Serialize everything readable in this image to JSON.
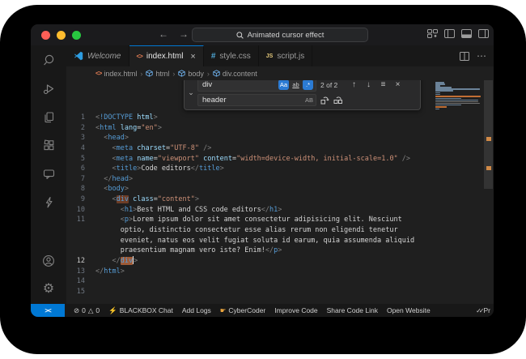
{
  "titlebar": {
    "search_query": "Animated cursor effect",
    "back": "←",
    "forward": "→"
  },
  "tabs": [
    {
      "label": "Welcome"
    },
    {
      "label": "index.html",
      "close": "×"
    },
    {
      "label": "style.css"
    },
    {
      "label": "script.js"
    }
  ],
  "file_icons": {
    "html": "<>",
    "css": "#",
    "js": "JS"
  },
  "breadcrumb": {
    "items": [
      "index.html",
      "html",
      "body",
      "div.content"
    ],
    "separator": "›"
  },
  "find": {
    "query": "div",
    "match_case": "Aa",
    "whole_word": "ab",
    "regex": ".*",
    "results": "2 of 2",
    "replace_value": "header",
    "preserve_case": "AB",
    "prev": "↑",
    "next": "↓",
    "in_selection": "≡",
    "close": "×",
    "collapse": "⌄"
  },
  "code": {
    "rows": [
      {
        "n": "1",
        "seg": [
          [
            "<",
            "p"
          ],
          [
            "!DOCTYPE",
            "t"
          ],
          [
            " html",
            "a"
          ],
          [
            ">",
            "p"
          ]
        ]
      },
      {
        "n": "2",
        "seg": [
          [
            "<",
            "p"
          ],
          [
            "html",
            "t"
          ],
          [
            " ",
            "x"
          ],
          [
            "lang",
            "a"
          ],
          [
            "=",
            "x"
          ],
          [
            "\"en\"",
            "s"
          ],
          [
            ">",
            "p"
          ]
        ]
      },
      {
        "n": "3",
        "seg": [
          [
            "  ",
            "x"
          ],
          [
            "<",
            "p"
          ],
          [
            "head",
            "t"
          ],
          [
            ">",
            "p"
          ]
        ]
      },
      {
        "n": "4",
        "seg": [
          [
            "    ",
            "x"
          ],
          [
            "<",
            "p"
          ],
          [
            "meta",
            "t"
          ],
          [
            " ",
            "x"
          ],
          [
            "charset",
            "a"
          ],
          [
            "=",
            "x"
          ],
          [
            "\"UTF-8\"",
            "s"
          ],
          [
            " />",
            "p"
          ]
        ]
      },
      {
        "n": "5",
        "seg": [
          [
            "    ",
            "x"
          ],
          [
            "<",
            "p"
          ],
          [
            "meta",
            "t"
          ],
          [
            " ",
            "x"
          ],
          [
            "name",
            "a"
          ],
          [
            "=",
            "x"
          ],
          [
            "\"viewport\"",
            "s"
          ],
          [
            " ",
            "x"
          ],
          [
            "content",
            "a"
          ],
          [
            "=",
            "x"
          ],
          [
            "\"width=device-width, initial-scale=1.0\"",
            "s"
          ],
          [
            " />",
            "p"
          ]
        ]
      },
      {
        "n": "6",
        "seg": [
          [
            "    ",
            "x"
          ],
          [
            "<",
            "p"
          ],
          [
            "title",
            "t"
          ],
          [
            ">",
            "p"
          ],
          [
            "Code editors",
            "x"
          ],
          [
            "</",
            "p"
          ],
          [
            "title",
            "t"
          ],
          [
            ">",
            "p"
          ]
        ]
      },
      {
        "n": "7",
        "seg": [
          [
            "  ",
            "x"
          ],
          [
            "</",
            "p"
          ],
          [
            "head",
            "t"
          ],
          [
            ">",
            "p"
          ]
        ]
      },
      {
        "n": "8",
        "seg": [
          [
            "  ",
            "x"
          ],
          [
            "<",
            "p"
          ],
          [
            "body",
            "t"
          ],
          [
            ">",
            "p"
          ]
        ]
      },
      {
        "n": "9",
        "seg": [
          [
            "    ",
            "x"
          ],
          [
            "<",
            "p"
          ],
          [
            "div",
            "t",
            "m"
          ],
          [
            " ",
            "x"
          ],
          [
            "class",
            "a"
          ],
          [
            "=",
            "x"
          ],
          [
            "\"content\"",
            "s"
          ],
          [
            ">",
            "p"
          ]
        ]
      },
      {
        "n": "10",
        "seg": [
          [
            "      ",
            "x"
          ],
          [
            "<",
            "p"
          ],
          [
            "h1",
            "t"
          ],
          [
            ">",
            "p"
          ],
          [
            "Best HTML and CSS code editors",
            "x"
          ],
          [
            "</",
            "p"
          ],
          [
            "h1",
            "t"
          ],
          [
            ">",
            "p"
          ]
        ]
      },
      {
        "n": "11",
        "seg": [
          [
            "      ",
            "x"
          ],
          [
            "<",
            "p"
          ],
          [
            "p",
            "t"
          ],
          [
            ">",
            "p"
          ],
          [
            "Lorem ipsum dolor sit amet consectetur adipisicing elit. Nesciunt",
            "x"
          ]
        ]
      },
      {
        "n": "",
        "seg": [
          [
            "      ",
            "x"
          ],
          [
            "optio, distinctio consectetur esse alias rerum non eligendi tenetur",
            "x"
          ]
        ]
      },
      {
        "n": "",
        "seg": [
          [
            "      ",
            "x"
          ],
          [
            "eveniet, natus eos velit fugiat soluta id earum, quia assumenda aliquid",
            "x"
          ]
        ]
      },
      {
        "n": "",
        "seg": [
          [
            "      ",
            "x"
          ],
          [
            "praesentium magnam vero iste? Enim!",
            "x"
          ],
          [
            "</",
            "p"
          ],
          [
            "p",
            "t"
          ],
          [
            ">",
            "p"
          ]
        ]
      },
      {
        "n": "12",
        "cur": true,
        "seg": [
          [
            "    ",
            "x"
          ],
          [
            "</",
            "p"
          ],
          [
            "div",
            "t",
            "c"
          ],
          [
            ">",
            "p"
          ]
        ]
      },
      {
        "n": "13",
        "seg": [
          [
            "</",
            "p"
          ],
          [
            "html",
            "t"
          ],
          [
            ">",
            "p"
          ]
        ]
      },
      {
        "n": "14",
        "seg": []
      },
      {
        "n": "15",
        "seg": []
      }
    ]
  },
  "statusbar": {
    "remote": "><",
    "errors_icon": "⊘",
    "errors": "0",
    "warnings_icon": "△",
    "warnings": "0",
    "bolt_icon": "⚡",
    "blackbox_chat": "BLACKBOX Chat",
    "add_logs": "Add Logs",
    "hand_icon": "☛",
    "cybercoder": "CyberCoder",
    "improve_code": "Improve Code",
    "share_code_link": "Share Code Link",
    "open_website": "Open Website",
    "checks": "✓✓",
    "prettier_truncated": "Pr"
  },
  "colors": {
    "accent_blue": "#0078d4",
    "find_match": "#6d3d26",
    "find_match_current": "#9e5a36",
    "ruler_mark": "#d18a47"
  }
}
